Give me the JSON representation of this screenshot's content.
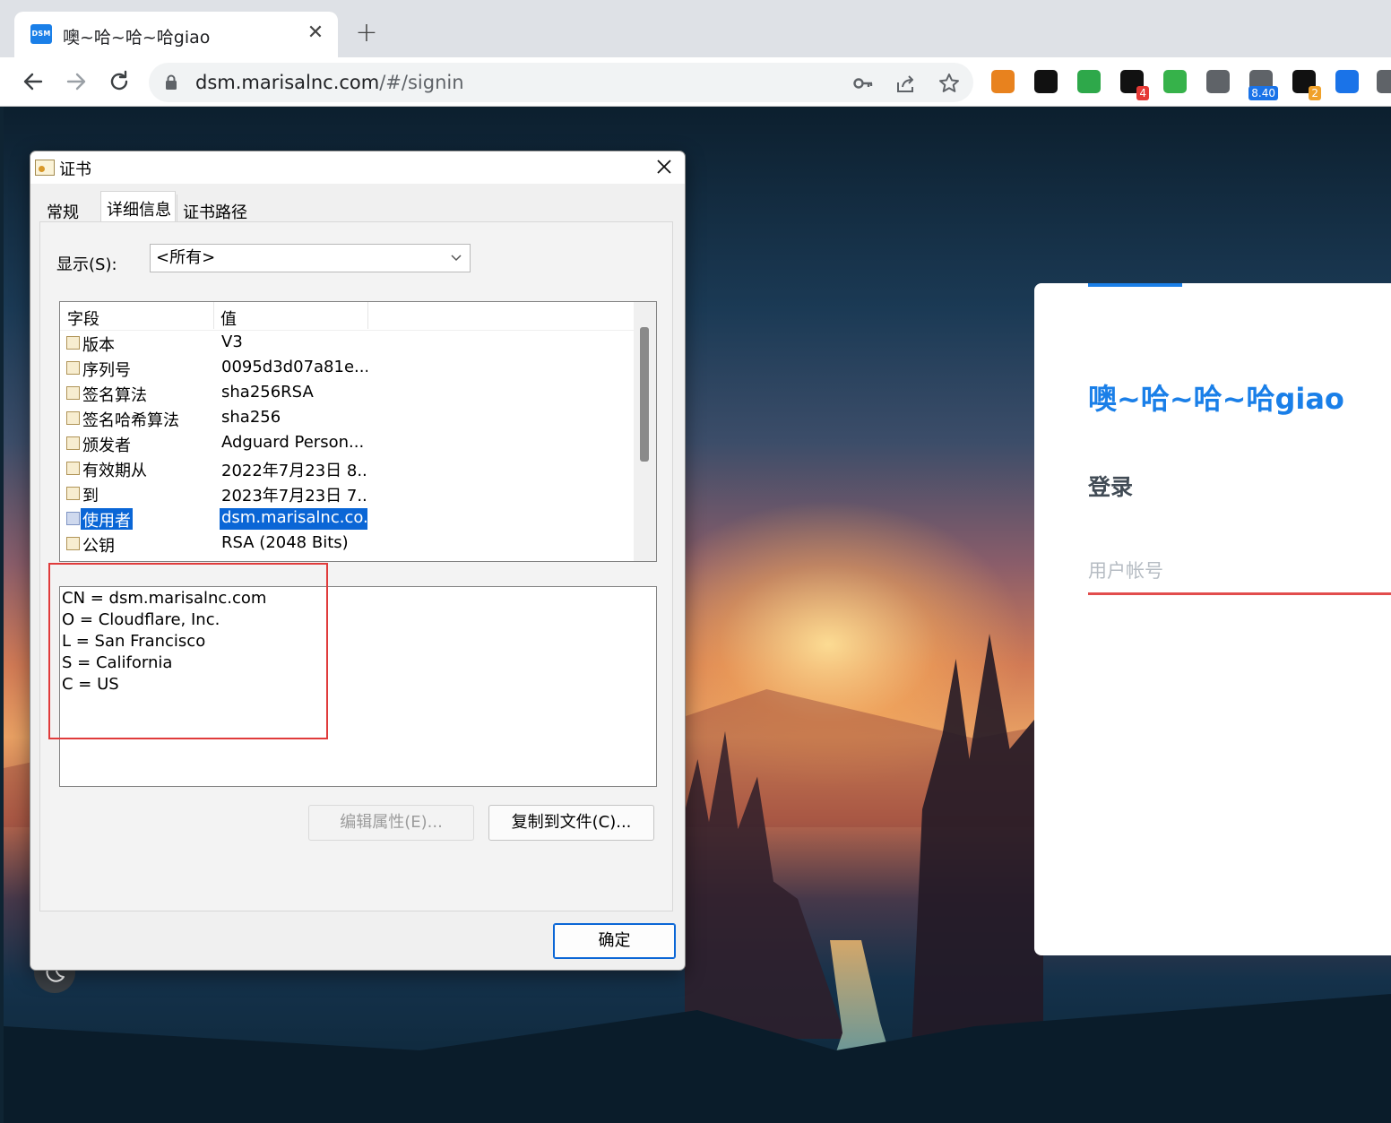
{
  "browser": {
    "tab_title": "噢~哈~哈~哈giao",
    "tab_favicon_text": "DSM",
    "tab_close": "✕",
    "new_tab": "+",
    "url_host": "dsm.marisalnc.com",
    "url_path": "/#/signin",
    "extensions": [
      {
        "name": "metamask-extension-icon",
        "color": "#e8821e"
      },
      {
        "name": "dice-extension-icon",
        "color": "#111111"
      },
      {
        "name": "shield-check-extension-icon",
        "color": "#2ea84a"
      },
      {
        "name": "chat-extension-icon",
        "color": "#111111",
        "badge": "4",
        "badge_color": "#e53935"
      },
      {
        "name": "adguard-extension-icon",
        "color": "#36b24a"
      },
      {
        "name": "copy-extension-icon",
        "color": "#5f6368"
      },
      {
        "name": "network-extension-icon",
        "color": "#5f6368",
        "badge": "8.40",
        "badge_color": "#1a73e8"
      },
      {
        "name": "circle-extension-icon",
        "color": "#111111",
        "badge": "2",
        "badge_color": "#f0a12a"
      },
      {
        "name": "document-download-extension-icon",
        "color": "#1a73e8"
      },
      {
        "name": "puzzle-extension-icon",
        "color": "#5f6368"
      }
    ]
  },
  "login": {
    "site_title": "噢~哈~哈~哈giao",
    "heading": "登录",
    "username_placeholder": "用户帐号",
    "accent_color": "#1a7fe8",
    "error_underline_color": "#e24d4d"
  },
  "dialog": {
    "title": "证书",
    "tabs": [
      "常规",
      "详细信息",
      "证书路径"
    ],
    "active_tab": "详细信息",
    "show_label": "显示(S):",
    "show_value": "<所有>",
    "columns": [
      "字段",
      "值"
    ],
    "rows": [
      {
        "field": "版本",
        "value": "V3"
      },
      {
        "field": "序列号",
        "value": "0095d3d07a81e..."
      },
      {
        "field": "签名算法",
        "value": "sha256RSA"
      },
      {
        "field": "签名哈希算法",
        "value": "sha256"
      },
      {
        "field": "颁发者",
        "value": "Adguard Person..."
      },
      {
        "field": "有效期从",
        "value": "2022年7月23日 8..."
      },
      {
        "field": "到",
        "value": "2023年7月23日 7..."
      },
      {
        "field": "使用者",
        "value": "dsm.marisalnc.co...",
        "selected": true
      },
      {
        "field": "公钥",
        "value": "RSA (2048 Bits)"
      }
    ],
    "detail_lines": [
      "CN = dsm.marisalnc.com",
      "O = Cloudflare, Inc.",
      "L = San Francisco",
      "S = California",
      "C = US"
    ],
    "edit_button": "编辑属性(E)...",
    "copy_button": "复制到文件(C)...",
    "ok_button": "确定",
    "highlight_color": "#e03b3b"
  }
}
